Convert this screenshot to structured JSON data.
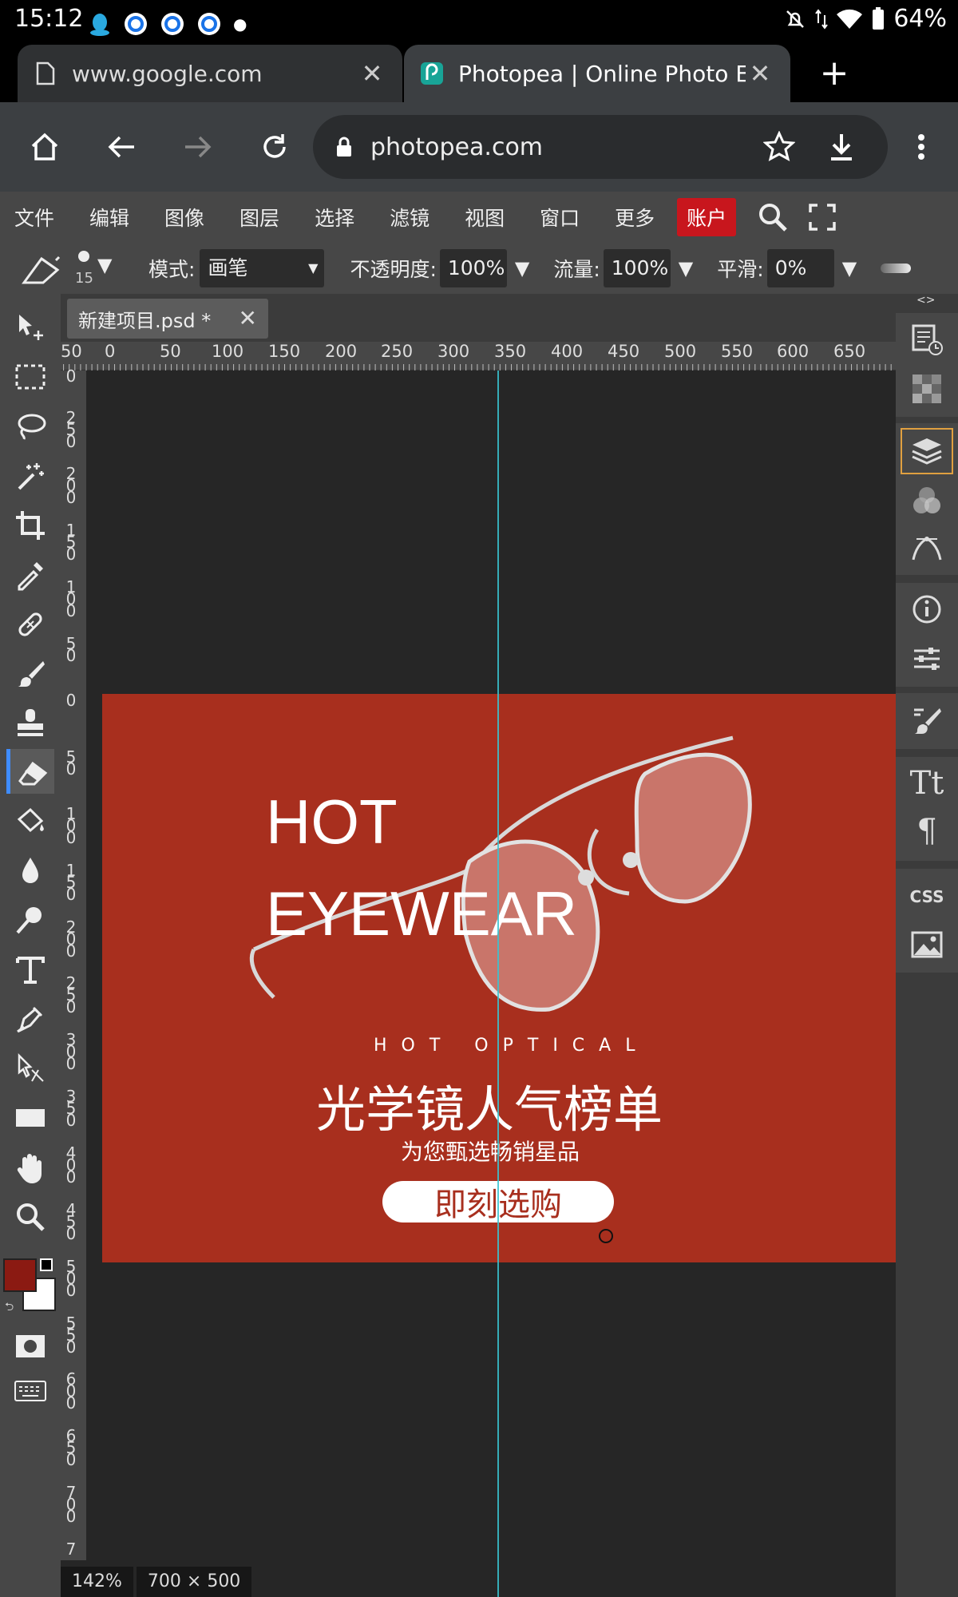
{
  "status_bar": {
    "time": "15:12",
    "battery": "64%"
  },
  "tabs": [
    {
      "title": "www.google.com",
      "active": false
    },
    {
      "title": "Photopea | Online Photo Edit",
      "active": true
    }
  ],
  "address": {
    "url": "photopea.com"
  },
  "menu": {
    "items": [
      "文件",
      "编辑",
      "图像",
      "图层",
      "选择",
      "滤镜",
      "视图",
      "窗口",
      "更多"
    ],
    "account": "账户"
  },
  "options": {
    "brush_size": "15",
    "mode_label": "模式:",
    "mode_value": "画笔",
    "opacity_label": "不透明度:",
    "opacity_value": "100%",
    "flow_label": "流量:",
    "flow_value": "100%",
    "smooth_label": "平滑:",
    "smooth_value": "0%"
  },
  "document": {
    "tab_title": "新建项目.psd *"
  },
  "ruler": {
    "h_labels": [
      "50",
      "0",
      "50",
      "100",
      "150",
      "200",
      "250",
      "300",
      "350",
      "400",
      "450",
      "500",
      "550",
      "600",
      "650"
    ],
    "v_labels": [
      "0",
      "250",
      "200",
      "150",
      "100",
      "50",
      "0",
      "50",
      "100",
      "150",
      "200",
      "250",
      "300",
      "350",
      "400",
      "450",
      "500",
      "550",
      "600",
      "650",
      "700",
      "7"
    ]
  },
  "banner": {
    "headline_1": "HOT",
    "headline_2": "EYEWEAR",
    "subtitle_en": "HOT OPTICAL",
    "title_cn": "光学镜人气榜单",
    "subtitle_cn": "为您甄选畅销星品",
    "cta": "即刻选购"
  },
  "colors": {
    "foreground": "#8b1a12",
    "background": "#ffffff",
    "banner_bg": "#a82f1e",
    "guide": "#38c4d1",
    "account_bg": "#c8161d"
  },
  "footer": {
    "zoom": "142%",
    "size": "700 × 500"
  },
  "right_panel": {
    "css_label": "CSS"
  }
}
